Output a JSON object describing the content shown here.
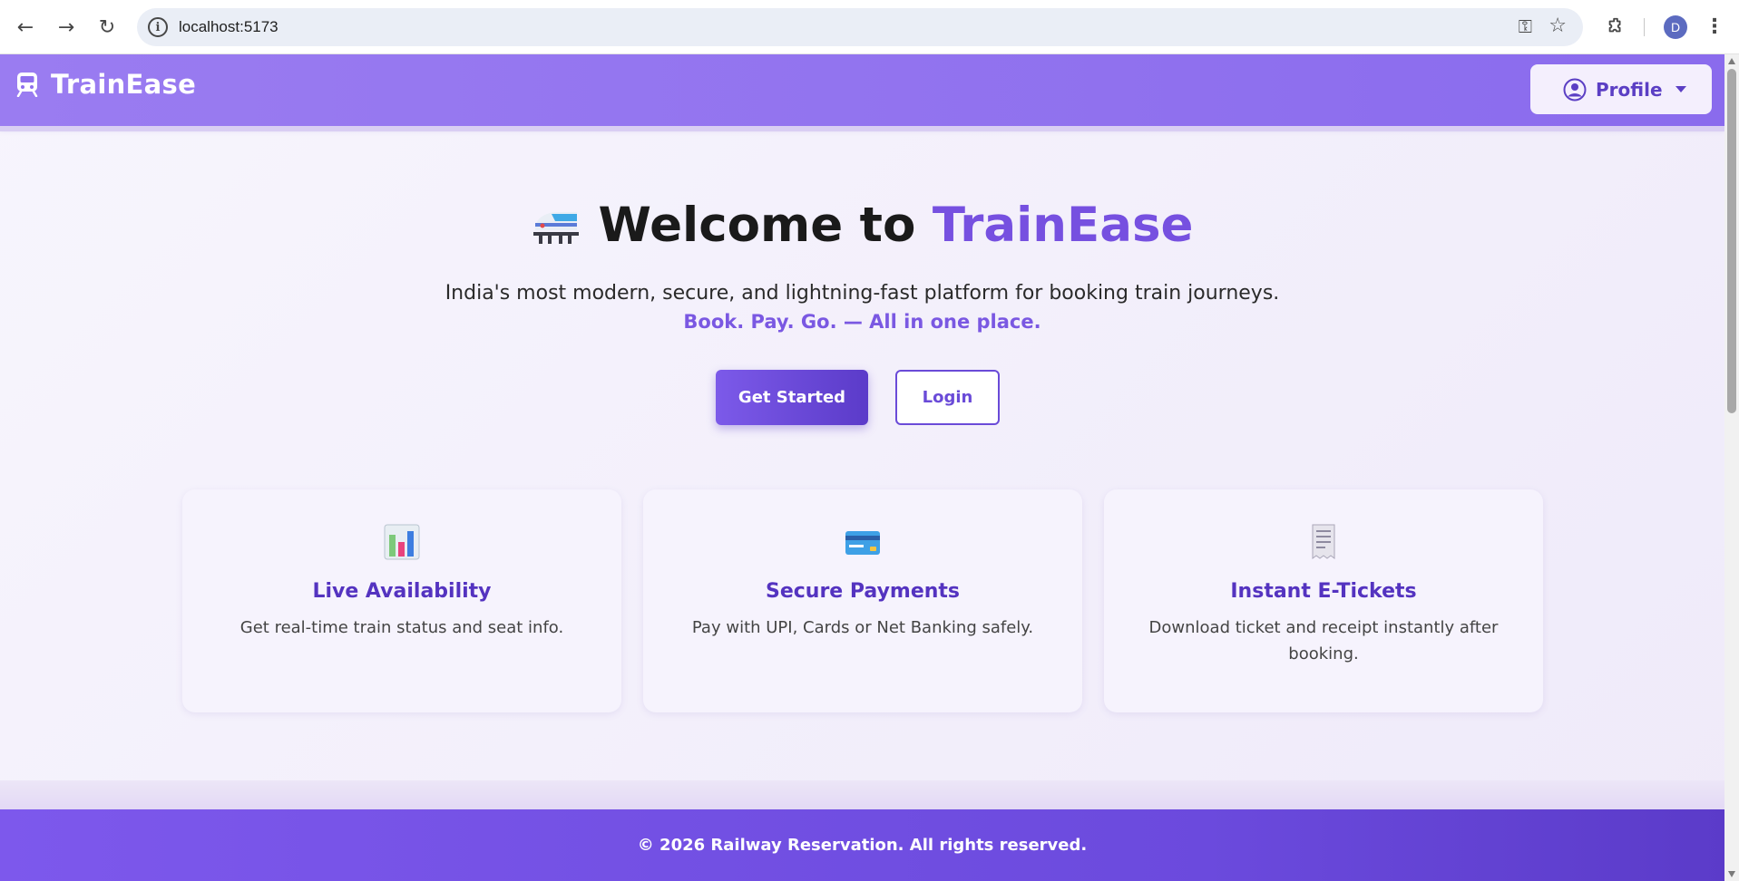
{
  "browser": {
    "url": "localhost:5173",
    "profile_initial": "D"
  },
  "navbar": {
    "brand": "TrainEase",
    "profile_label": "Profile"
  },
  "hero": {
    "title_prefix": "Welcome to ",
    "title_accent": "TrainEase",
    "tagline": "India's most modern, secure, and lightning-fast platform for booking train journeys.",
    "subline": "Book. Pay. Go. — All in one place.",
    "primary_button": "Get Started",
    "secondary_button": "Login"
  },
  "features": [
    {
      "icon": "bar-chart-icon",
      "title": "Live Availability",
      "description": "Get real-time train status and seat info."
    },
    {
      "icon": "credit-card-icon",
      "title": "Secure Payments",
      "description": "Pay with UPI, Cards or Net Banking safely."
    },
    {
      "icon": "receipt-icon",
      "title": "Instant E-Tickets",
      "description": "Download ticket and receipt instantly after booking."
    }
  ],
  "footer": {
    "text": "© 2026 Railway Reservation. All rights reserved."
  },
  "colors": {
    "brand_purple": "#7650e0",
    "navbar": "#9a7cf1",
    "footer": "#6b4add",
    "card_title": "#5433c0"
  }
}
